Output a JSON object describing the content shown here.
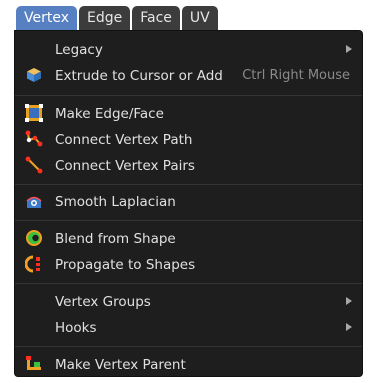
{
  "tabs": [
    {
      "label": "Vertex",
      "active": true
    },
    {
      "label": "Edge",
      "active": false
    },
    {
      "label": "Face",
      "active": false
    },
    {
      "label": "UV",
      "active": false
    }
  ],
  "menu": {
    "legacy": {
      "label": "Legacy",
      "submenu": true
    },
    "extrude": {
      "label": "Extrude to Cursor or Add",
      "shortcut": "Ctrl Right Mouse",
      "icon": "extrude-icon"
    },
    "make_edge_face": {
      "label": "Make Edge/Face",
      "icon": "make-edge-face-icon"
    },
    "connect_path": {
      "label": "Connect Vertex Path",
      "icon": "connect-path-icon"
    },
    "connect_pairs": {
      "label": "Connect Vertex Pairs",
      "icon": "connect-pairs-icon"
    },
    "smooth_laplacian": {
      "label": "Smooth Laplacian",
      "icon": "smooth-laplacian-icon"
    },
    "blend_shape": {
      "label": "Blend from Shape",
      "icon": "blend-shape-icon"
    },
    "propagate_shapes": {
      "label": "Propagate to Shapes",
      "icon": "propagate-shapes-icon"
    },
    "vertex_groups": {
      "label": "Vertex Groups",
      "submenu": true
    },
    "hooks": {
      "label": "Hooks",
      "submenu": true
    },
    "make_parent": {
      "label": "Make Vertex Parent",
      "icon": "make-parent-icon"
    }
  },
  "colors": {
    "menu_bg": "#1e1e1e",
    "tab_active": "#5680c2",
    "tab_inactive": "#3c3c3c",
    "text": "#e0e0e0",
    "shortcut_text": "#8a8a8a"
  }
}
